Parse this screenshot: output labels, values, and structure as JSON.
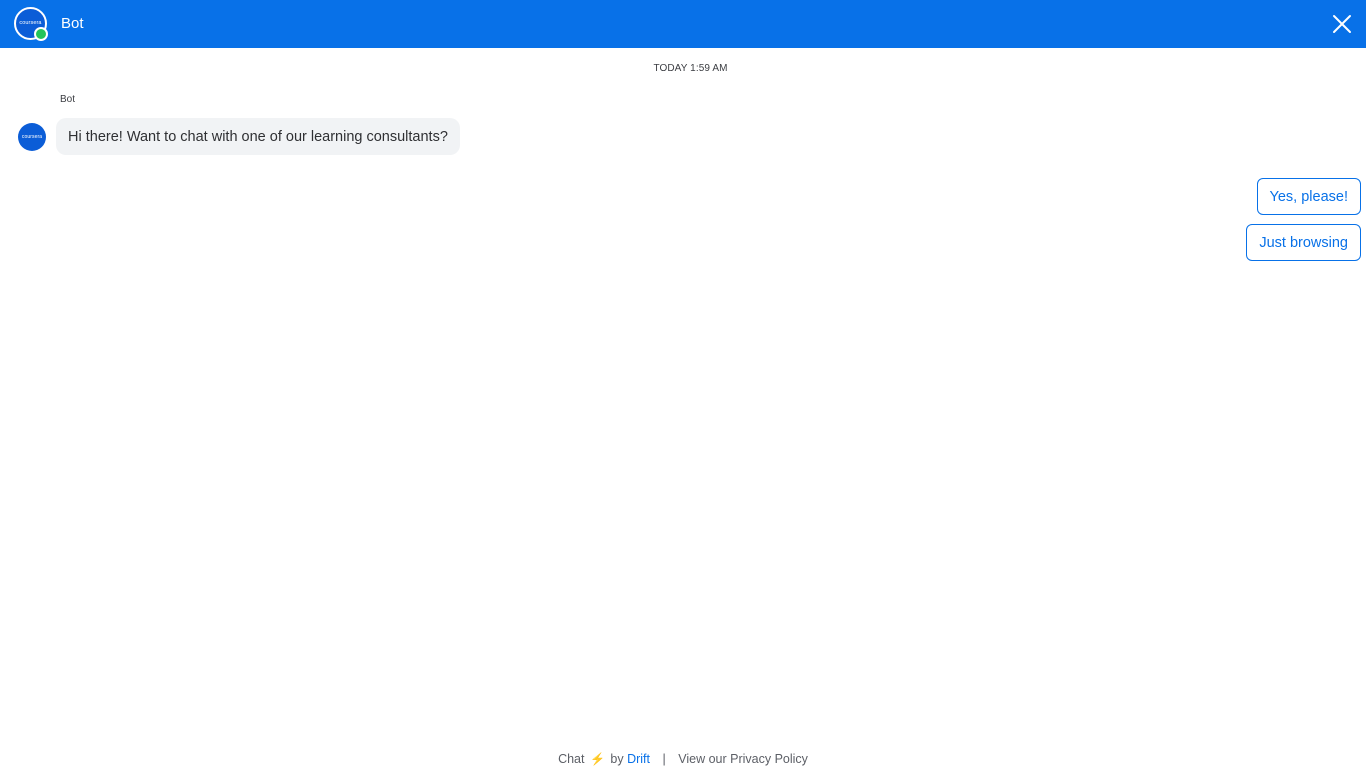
{
  "header": {
    "title": "Bot",
    "logo_text": "coursera",
    "status": "online",
    "colors": {
      "background": "#0871e8",
      "status_dot": "#23c45a"
    }
  },
  "conversation": {
    "timestamp": "TODAY 1:59 AM",
    "messages": [
      {
        "sender": "Bot",
        "avatar_text": "coursera",
        "text": "Hi there! Want to chat with one of our learning consultants?"
      }
    ],
    "quick_replies": [
      {
        "label": "Yes, please!"
      },
      {
        "label": "Just browsing"
      }
    ]
  },
  "footer": {
    "chat_label": "Chat",
    "bolt_icon": "lightning-bolt-icon",
    "by_label": "by",
    "brand": "Drift",
    "separator": "|",
    "privacy_label": "View our Privacy Policy"
  }
}
